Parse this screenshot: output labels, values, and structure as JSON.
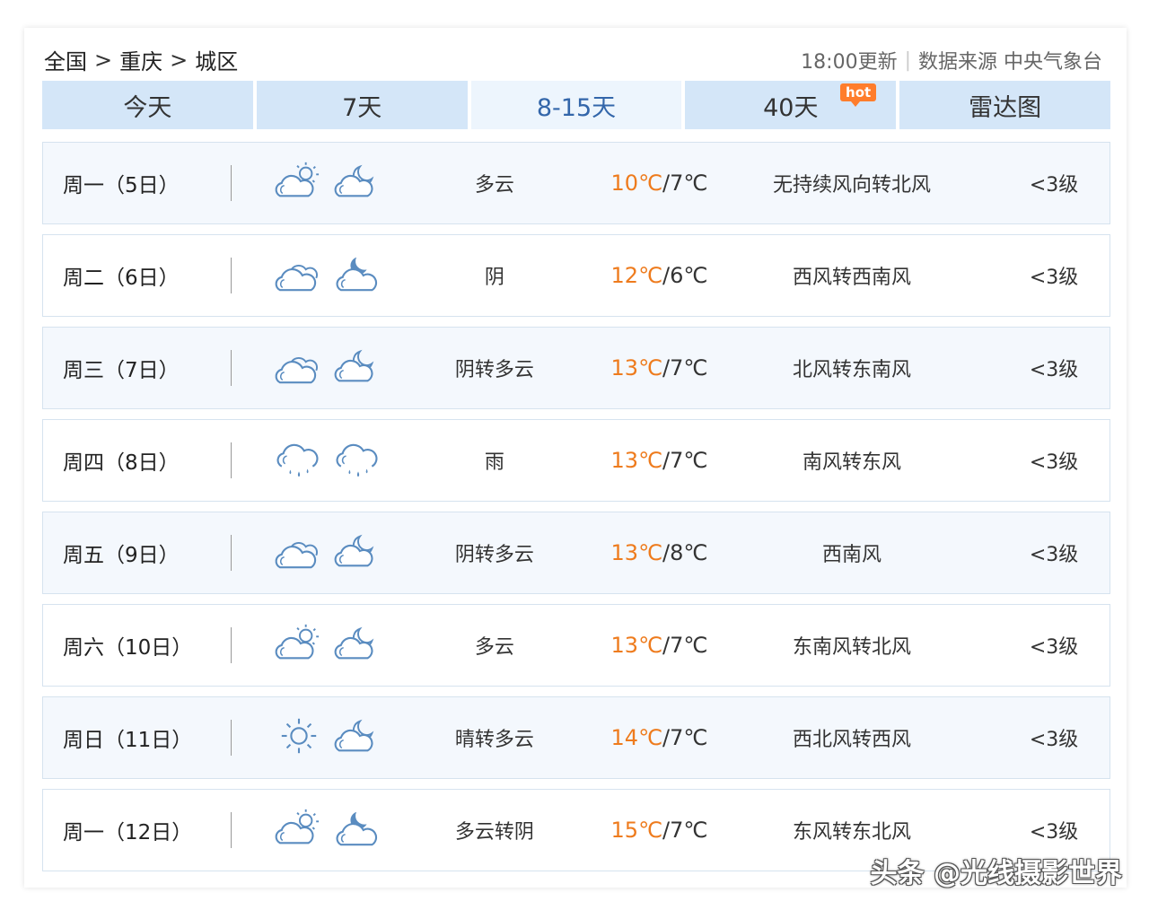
{
  "breadcrumb": {
    "country": "全国",
    "city": "重庆",
    "district": "城区",
    "sep": ">"
  },
  "update": {
    "time": "18:00更新",
    "divider": "|",
    "source": "数据来源 中央气象台"
  },
  "tabs": [
    {
      "label": "今天"
    },
    {
      "label": "7天"
    },
    {
      "label": "8-15天"
    },
    {
      "label": "40天",
      "badge": "hot"
    },
    {
      "label": "雷达图"
    }
  ],
  "colors": {
    "accent": "#ee7b1d",
    "tab_bg": "#d4e6f8",
    "tab_active": "#3366aa",
    "hot": "#ff7d2c"
  },
  "rows": [
    {
      "day": "周一（5日）",
      "icon_day": "partly-cloudy-icon",
      "icon_night": "cloudy-night-icon",
      "cond": "多云",
      "hi": "10℃",
      "lo": "/7℃",
      "wind": "无持续风向转北风",
      "level": "<3级"
    },
    {
      "day": "周二（6日）",
      "icon_day": "overcast-icon",
      "icon_night": "cloudy-moon-icon",
      "cond": "阴",
      "hi": "12℃",
      "lo": "/6℃",
      "wind": "西风转西南风",
      "level": "<3级"
    },
    {
      "day": "周三（7日）",
      "icon_day": "overcast-icon",
      "icon_night": "cloudy-night-icon",
      "cond": "阴转多云",
      "hi": "13℃",
      "lo": "/7℃",
      "wind": "北风转东南风",
      "level": "<3级"
    },
    {
      "day": "周四（8日）",
      "icon_day": "rain-icon",
      "icon_night": "rain-icon",
      "cond": "雨",
      "hi": "13℃",
      "lo": "/7℃",
      "wind": "南风转东风",
      "level": "<3级"
    },
    {
      "day": "周五（9日）",
      "icon_day": "overcast-icon",
      "icon_night": "cloudy-night-icon",
      "cond": "阴转多云",
      "hi": "13℃",
      "lo": "/8℃",
      "wind": "西南风",
      "level": "<3级"
    },
    {
      "day": "周六（10日）",
      "icon_day": "partly-cloudy-icon",
      "icon_night": "cloudy-night-icon",
      "cond": "多云",
      "hi": "13℃",
      "lo": "/7℃",
      "wind": "东南风转北风",
      "level": "<3级"
    },
    {
      "day": "周日（11日）",
      "icon_day": "sun-icon",
      "icon_night": "cloudy-night-icon",
      "cond": "晴转多云",
      "hi": "14℃",
      "lo": "/7℃",
      "wind": "西北风转西风",
      "level": "<3级"
    },
    {
      "day": "周一（12日）",
      "icon_day": "partly-cloudy-icon",
      "icon_night": "cloudy-moon-icon",
      "cond": "多云转阴",
      "hi": "15℃",
      "lo": "/7℃",
      "wind": "东风转东北风",
      "level": "<3级"
    }
  ],
  "watermark": "头条 @光线摄影世界"
}
